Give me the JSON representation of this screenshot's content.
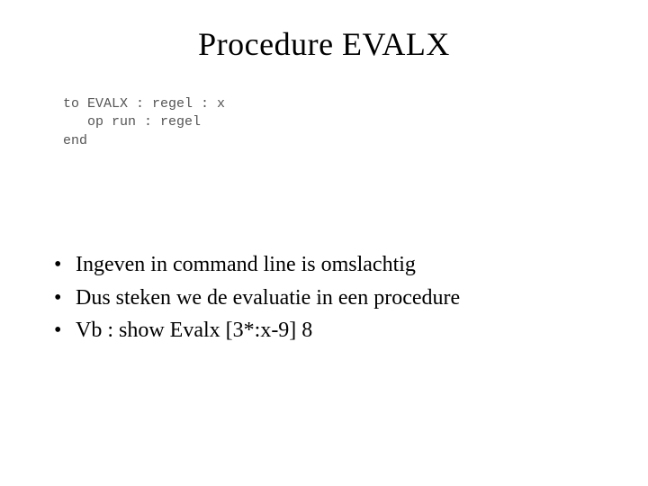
{
  "title": "Procedure EVALX",
  "code": {
    "line1": "to EVALX : regel : x",
    "line2": "   op run : regel",
    "line3": "end"
  },
  "bullets": [
    "Ingeven in command line is omslachtig",
    "Dus steken we de evaluatie in een procedure",
    "Vb : show Evalx [3*:x-9] 8"
  ]
}
